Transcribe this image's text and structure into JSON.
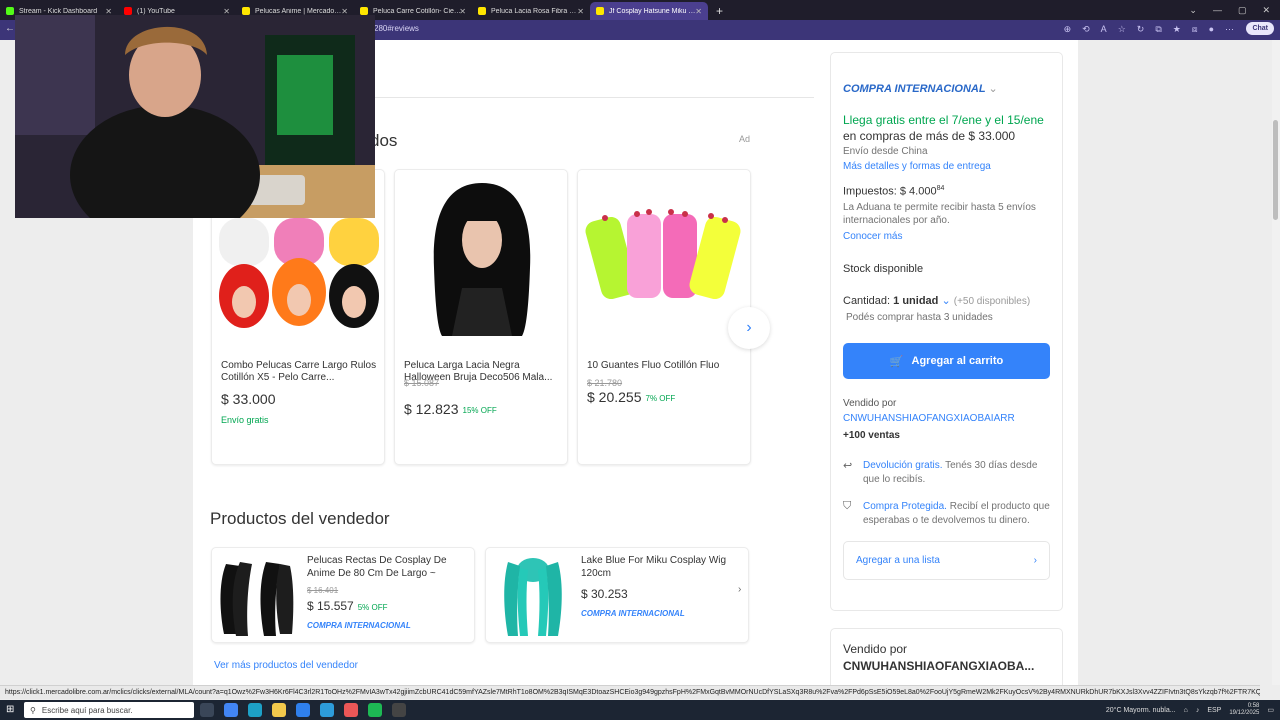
{
  "browser": {
    "tabs": [
      {
        "label": "Stream - Kick Dashboard",
        "color": "#53fc18",
        "active": false
      },
      {
        "label": "(1) YouTube",
        "color": "#ff0000",
        "active": false
      },
      {
        "label": "Pelucas Anime | MercadoLibre",
        "color": "#ffe600",
        "active": false
      },
      {
        "label": "Peluca Carre Cotillón- Cienfuegos",
        "color": "#ffe600",
        "active": false
      },
      {
        "label": "Peluca Lacia Rosa Fibra Sintetica C",
        "color": "#ffe600",
        "active": false
      },
      {
        "label": "Jf Cosplay Hatsune Miku Personaj",
        "color": "#ffe600",
        "active": true
      }
    ],
    "url_fragment": "280#reviews",
    "chat_label": "Chat"
  },
  "main": {
    "section_suffix": "dos",
    "ad_label": "Ad",
    "recommended": [
      {
        "title": "Combo Pelucas Carre Largo Rulos Cotillón X5 - Pelo Carre...",
        "old_price": "",
        "price": "$ 33.000",
        "off": "",
        "shipping": "Envío gratis"
      },
      {
        "title": "Peluca Larga Lacia Negra Halloween Bruja Deco506 Mala...",
        "old_price": "$ 15.087",
        "price": "$ 12.823",
        "off": "15% OFF",
        "shipping": ""
      },
      {
        "title": "10 Guantes Fluo Cotillón Fluo",
        "old_price": "$ 21.780",
        "price": "$ 20.255",
        "off": "7% OFF",
        "shipping": ""
      }
    ],
    "seller_section_title": "Productos del vendedor",
    "seller_products": [
      {
        "title": "Pelucas Rectas De Cosplay De Anime De 80 Cm De Largo ~",
        "old_price": "$ 16.401",
        "price": "$ 15.557",
        "off": "5% OFF",
        "intl": "COMPRA INTERNACIONAL"
      },
      {
        "title": "Lake Blue For Miku Cosplay Wig 120cm",
        "old_price": "",
        "price": "$ 30.253",
        "off": "",
        "intl": "COMPRA INTERNACIONAL"
      }
    ],
    "more_link": "Ver más productos del vendedor"
  },
  "sidebar": {
    "intl_label": "COMPRA INTERNACIONAL",
    "free_shipping": "Llega gratis entre el 7/ene y el 15/ene",
    "min_purchase": "en compras de más de $ 33.000",
    "ships_from": "Envío desde China",
    "delivery_link": "Más detalles y formas de entrega",
    "taxes_label": "Impuestos: $ 4.000",
    "taxes_cents": "84",
    "customs_note": "La Aduana te permite recibir hasta 5 envíos internacionales por año.",
    "learn_more": "Conocer más",
    "stock": "Stock disponible",
    "quantity_label": "Cantidad:",
    "quantity_value": "1 unidad",
    "available": "(+50 disponibles)",
    "limit_note": "Podés comprar hasta 3 unidades",
    "add_to_cart": "Agregar al carrito",
    "sold_by_label": "Vendido por",
    "seller_name": "CNWUHANSHIAOFANGXIAOBAIARR",
    "sales": "+100 ventas",
    "return_link": "Devolución gratis.",
    "return_text": "Tenés 30 días desde que lo recibís.",
    "protect_link": "Compra Protegida.",
    "protect_text": "Recibí el producto que esperabas o te devolvemos tu dinero.",
    "add_to_list": "Agregar a una lista",
    "sold_by_label_2": "Vendido por",
    "seller_name_2": "CNWUHANSHIAOFANGXIAOBA..."
  },
  "status_url": "https://click1.mercadolibre.com.ar/mclics/clicks/external/MLA/count?a=q1Owz%2Fw3H6Kr6Fl4C3rl2R1ToOHz%2FMvIA3wTx42gjiimZcbURC41dC59mfYAZsle7MtRhT1o8OM%2B3qISMqE3DtoazSHCEio3g949gpzhsFpH%2FMxGqtBvMMOrNUcDfYSLaSXq3R8u%2Fva%2FPd6pSsE5iO59eL8a0%2FooUjY5gRmeW2Mk2FKuyOcsV%2By4RMXNURkDhUR7bKXJsl3Xvv4ZZIFIvtn3tQ8sYkzqb7f%2FTR7KQ%2B7PE4pT3",
  "taskbar": {
    "search_placeholder": "Escribe aquí para buscar.",
    "weather": "20°C  Mayorm. nubla...",
    "lang": "ESP",
    "time": "0:58",
    "date": "19/12/2025"
  }
}
